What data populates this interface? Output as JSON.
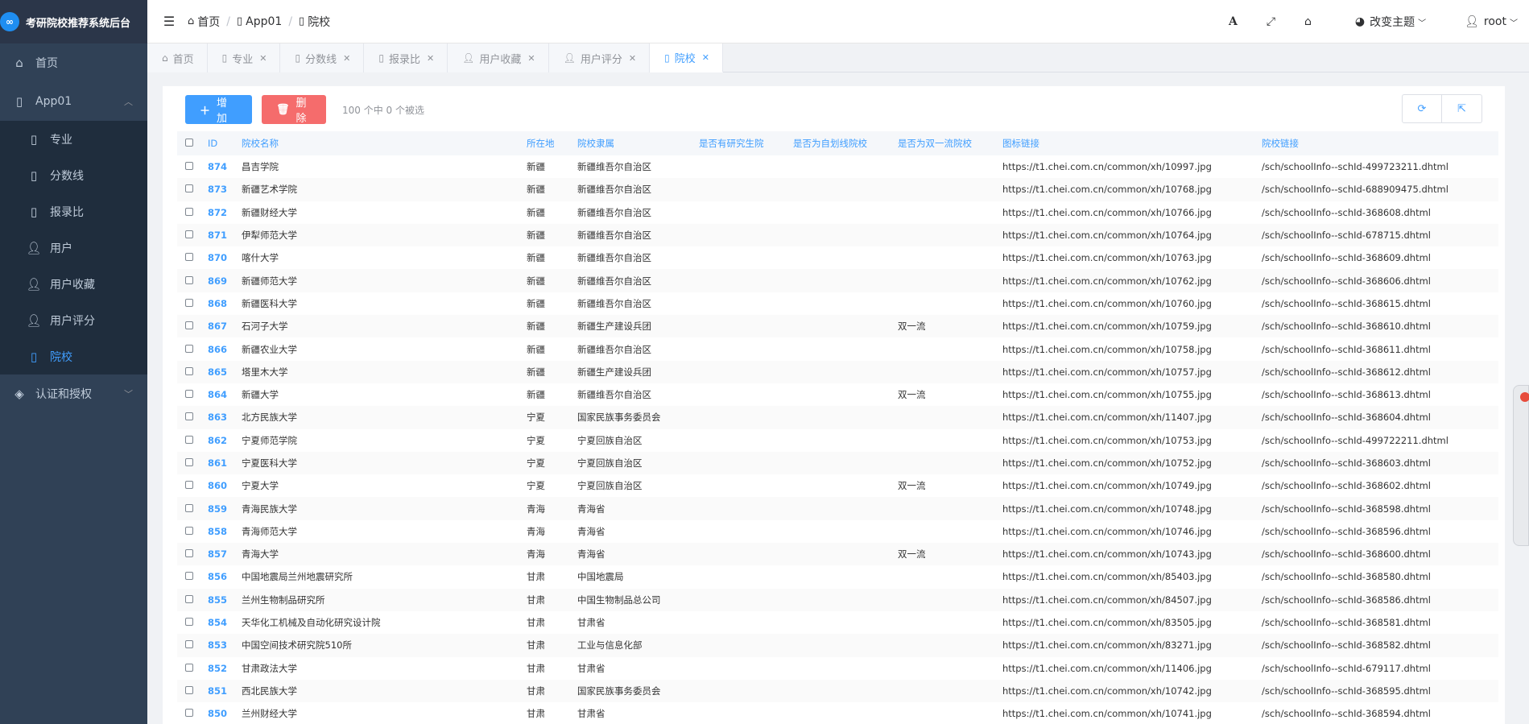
{
  "app": {
    "logo_glyph": "∞",
    "title": "考研院校推荐系统后台"
  },
  "sidebar": {
    "items": [
      {
        "label": "首页",
        "icon": "home-icon"
      },
      {
        "label": "App01",
        "icon": "file-icon",
        "expanded": true,
        "children": [
          {
            "label": "专业",
            "icon": "file-icon"
          },
          {
            "label": "分数线",
            "icon": "file-icon"
          },
          {
            "label": "报录比",
            "icon": "file-icon"
          },
          {
            "label": "用户",
            "icon": "user-icon"
          },
          {
            "label": "用户收藏",
            "icon": "user-icon"
          },
          {
            "label": "用户评分",
            "icon": "user-icon"
          },
          {
            "label": "院校",
            "icon": "file-icon",
            "active": true
          }
        ]
      },
      {
        "label": "认证和授权",
        "icon": "shield-icon"
      }
    ]
  },
  "header": {
    "breadcrumb": [
      "首页",
      "App01",
      "院校"
    ],
    "theme_label": "改变主题",
    "user_label": "root"
  },
  "tabs": [
    {
      "label": "首页",
      "icon": "home-icon",
      "closable": false
    },
    {
      "label": "专业",
      "icon": "file-icon",
      "closable": true
    },
    {
      "label": "分数线",
      "icon": "file-icon",
      "closable": true
    },
    {
      "label": "报录比",
      "icon": "file-icon",
      "closable": true
    },
    {
      "label": "用户收藏",
      "icon": "user-icon",
      "closable": true
    },
    {
      "label": "用户评分",
      "icon": "user-icon",
      "closable": true
    },
    {
      "label": "院校",
      "icon": "file-icon",
      "closable": true,
      "active": true
    }
  ],
  "toolbar": {
    "add_label": "增加",
    "delete_label": "删除",
    "selection_info": "100 个中 0 个被选"
  },
  "table": {
    "columns": [
      "ID",
      "院校名称",
      "所在地",
      "院校隶属",
      "是否有研究生院",
      "是否为自划线院校",
      "是否为双一流院校",
      "图标链接",
      "院校链接"
    ],
    "rows": [
      [
        "874",
        "昌吉学院",
        "新疆",
        "新疆维吾尔自治区",
        "",
        "",
        "",
        "https://t1.chei.com.cn/common/xh/10997.jpg",
        "/sch/schoolInfo--schId-499723211.dhtml"
      ],
      [
        "873",
        "新疆艺术学院",
        "新疆",
        "新疆维吾尔自治区",
        "",
        "",
        "",
        "https://t1.chei.com.cn/common/xh/10768.jpg",
        "/sch/schoolInfo--schId-688909475.dhtml"
      ],
      [
        "872",
        "新疆财经大学",
        "新疆",
        "新疆维吾尔自治区",
        "",
        "",
        "",
        "https://t1.chei.com.cn/common/xh/10766.jpg",
        "/sch/schoolInfo--schId-368608.dhtml"
      ],
      [
        "871",
        "伊犁师范大学",
        "新疆",
        "新疆维吾尔自治区",
        "",
        "",
        "",
        "https://t1.chei.com.cn/common/xh/10764.jpg",
        "/sch/schoolInfo--schId-678715.dhtml"
      ],
      [
        "870",
        "喀什大学",
        "新疆",
        "新疆维吾尔自治区",
        "",
        "",
        "",
        "https://t1.chei.com.cn/common/xh/10763.jpg",
        "/sch/schoolInfo--schId-368609.dhtml"
      ],
      [
        "869",
        "新疆师范大学",
        "新疆",
        "新疆维吾尔自治区",
        "",
        "",
        "",
        "https://t1.chei.com.cn/common/xh/10762.jpg",
        "/sch/schoolInfo--schId-368606.dhtml"
      ],
      [
        "868",
        "新疆医科大学",
        "新疆",
        "新疆维吾尔自治区",
        "",
        "",
        "",
        "https://t1.chei.com.cn/common/xh/10760.jpg",
        "/sch/schoolInfo--schId-368615.dhtml"
      ],
      [
        "867",
        "石河子大学",
        "新疆",
        "新疆生产建设兵团",
        "",
        "",
        "双一流",
        "https://t1.chei.com.cn/common/xh/10759.jpg",
        "/sch/schoolInfo--schId-368610.dhtml"
      ],
      [
        "866",
        "新疆农业大学",
        "新疆",
        "新疆维吾尔自治区",
        "",
        "",
        "",
        "https://t1.chei.com.cn/common/xh/10758.jpg",
        "/sch/schoolInfo--schId-368611.dhtml"
      ],
      [
        "865",
        "塔里木大学",
        "新疆",
        "新疆生产建设兵团",
        "",
        "",
        "",
        "https://t1.chei.com.cn/common/xh/10757.jpg",
        "/sch/schoolInfo--schId-368612.dhtml"
      ],
      [
        "864",
        "新疆大学",
        "新疆",
        "新疆维吾尔自治区",
        "",
        "",
        "双一流",
        "https://t1.chei.com.cn/common/xh/10755.jpg",
        "/sch/schoolInfo--schId-368613.dhtml"
      ],
      [
        "863",
        "北方民族大学",
        "宁夏",
        "国家民族事务委员会",
        "",
        "",
        "",
        "https://t1.chei.com.cn/common/xh/11407.jpg",
        "/sch/schoolInfo--schId-368604.dhtml"
      ],
      [
        "862",
        "宁夏师范学院",
        "宁夏",
        "宁夏回族自治区",
        "",
        "",
        "",
        "https://t1.chei.com.cn/common/xh/10753.jpg",
        "/sch/schoolInfo--schId-499722211.dhtml"
      ],
      [
        "861",
        "宁夏医科大学",
        "宁夏",
        "宁夏回族自治区",
        "",
        "",
        "",
        "https://t1.chei.com.cn/common/xh/10752.jpg",
        "/sch/schoolInfo--schId-368603.dhtml"
      ],
      [
        "860",
        "宁夏大学",
        "宁夏",
        "宁夏回族自治区",
        "",
        "",
        "双一流",
        "https://t1.chei.com.cn/common/xh/10749.jpg",
        "/sch/schoolInfo--schId-368602.dhtml"
      ],
      [
        "859",
        "青海民族大学",
        "青海",
        "青海省",
        "",
        "",
        "",
        "https://t1.chei.com.cn/common/xh/10748.jpg",
        "/sch/schoolInfo--schId-368598.dhtml"
      ],
      [
        "858",
        "青海师范大学",
        "青海",
        "青海省",
        "",
        "",
        "",
        "https://t1.chei.com.cn/common/xh/10746.jpg",
        "/sch/schoolInfo--schId-368596.dhtml"
      ],
      [
        "857",
        "青海大学",
        "青海",
        "青海省",
        "",
        "",
        "双一流",
        "https://t1.chei.com.cn/common/xh/10743.jpg",
        "/sch/schoolInfo--schId-368600.dhtml"
      ],
      [
        "856",
        "中国地震局兰州地震研究所",
        "甘肃",
        "中国地震局",
        "",
        "",
        "",
        "https://t1.chei.com.cn/common/xh/85403.jpg",
        "/sch/schoolInfo--schId-368580.dhtml"
      ],
      [
        "855",
        "兰州生物制品研究所",
        "甘肃",
        "中国生物制品总公司",
        "",
        "",
        "",
        "https://t1.chei.com.cn/common/xh/84507.jpg",
        "/sch/schoolInfo--schId-368586.dhtml"
      ],
      [
        "854",
        "天华化工机械及自动化研究设计院",
        "甘肃",
        "甘肃省",
        "",
        "",
        "",
        "https://t1.chei.com.cn/common/xh/83505.jpg",
        "/sch/schoolInfo--schId-368581.dhtml"
      ],
      [
        "853",
        "中国空间技术研究院510所",
        "甘肃",
        "工业与信息化部",
        "",
        "",
        "",
        "https://t1.chei.com.cn/common/xh/83271.jpg",
        "/sch/schoolInfo--schId-368582.dhtml"
      ],
      [
        "852",
        "甘肃政法大学",
        "甘肃",
        "甘肃省",
        "",
        "",
        "",
        "https://t1.chei.com.cn/common/xh/11406.jpg",
        "/sch/schoolInfo--schId-679117.dhtml"
      ],
      [
        "851",
        "西北民族大学",
        "甘肃",
        "国家民族事务委员会",
        "",
        "",
        "",
        "https://t1.chei.com.cn/common/xh/10742.jpg",
        "/sch/schoolInfo--schId-368595.dhtml"
      ],
      [
        "850",
        "兰州财经大学",
        "甘肃",
        "甘肃省",
        "",
        "",
        "",
        "https://t1.chei.com.cn/common/xh/10741.jpg",
        "/sch/schoolInfo--schId-368594.dhtml"
      ]
    ]
  },
  "colors": {
    "sidebar_bg": "#304156",
    "accent": "#409eff",
    "danger": "#f56c6c"
  }
}
